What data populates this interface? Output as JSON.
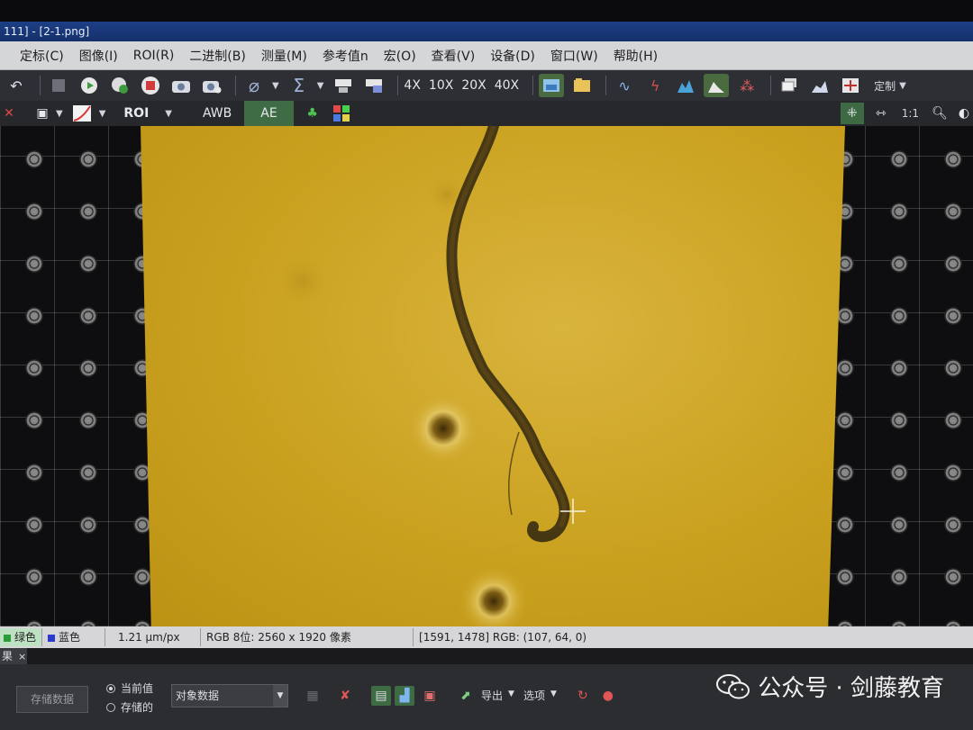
{
  "window": {
    "title": "111]  - [2-1.png]"
  },
  "menubar": {
    "items": [
      "定标(C)",
      "图像(I)",
      "ROI(R)",
      "二进制(B)",
      "测量(M)",
      "参考值n",
      "宏(O)",
      "查看(V)",
      "设备(D)",
      "窗口(W)",
      "帮助(H)"
    ]
  },
  "toolbar1": {
    "magnifications": [
      "4X",
      "10X",
      "20X",
      "40X"
    ],
    "custom_label": "定制"
  },
  "toolbar2": {
    "roi_label": "ROI",
    "awb_label": "AWB",
    "ae_label": "AE",
    "ratio_label": "1:1"
  },
  "statusbar": {
    "tab_green": "绿色",
    "tab_blue": "蓝色",
    "scale": "1.21 μm/px",
    "image_info": "RGB 8位: 2560 x 1920 像素",
    "cursor_info": "[1591, 1478] RGB: (107, 64, 0)"
  },
  "bottom_panel": {
    "tab_label": "果",
    "store_button": "存储数据",
    "radio_current": "当前值",
    "radio_stored": "存储的",
    "select_value": "对象数据",
    "export_label": "导出",
    "options_label": "选项"
  },
  "watermark": {
    "text": "公众号 · 剑藤教育"
  },
  "colors": {
    "menubar_bg": "#d5d6d8",
    "toolbar_bg": "#2e2f34",
    "ae_active": "#3f6b45",
    "specimen_bg": "#caa11f"
  }
}
